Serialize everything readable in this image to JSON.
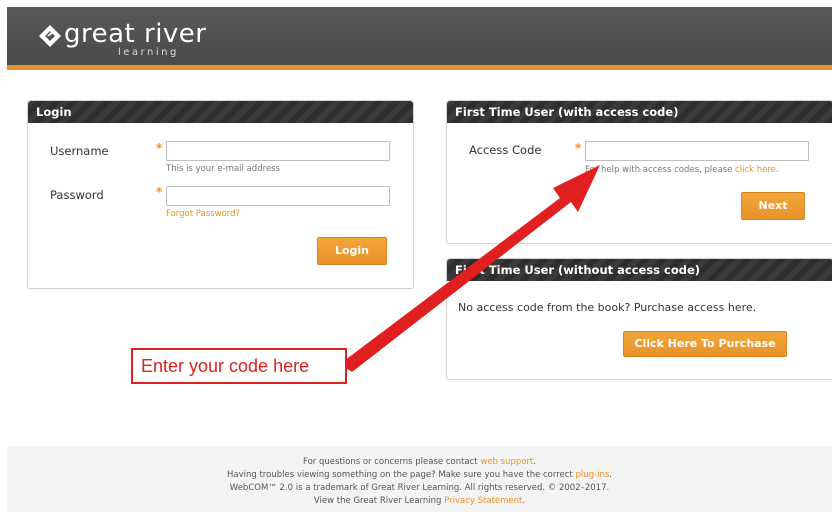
{
  "header": {
    "logo_text": "great river",
    "logo_subtext": "learning",
    "accent_color": "#e8922a"
  },
  "login": {
    "title": "Login",
    "username_label": "Username",
    "username_hint": "This is your e-mail address",
    "password_label": "Password",
    "forgot_link": "Forgot Password?",
    "required_mark": "*",
    "login_button": "Login"
  },
  "access_code_panel": {
    "title": "First Time User (with access code)",
    "access_code_label": "Access Code",
    "help_text": "For help with access codes, please",
    "help_link": "click here",
    "help_end": ".",
    "required_mark": "*",
    "next_button": "Next"
  },
  "purchase_panel": {
    "title": "First Time User (without access code)",
    "body": "No access code from the book? Purchase access here.",
    "purchase_button": "Click Here To Purchase"
  },
  "annotation": {
    "text": "Enter your code here",
    "color": "#e02020"
  },
  "footer": {
    "line1_text": "For questions or concerns please contact",
    "line1_link": "web support",
    "line1_end": ".",
    "line2_text": "Having troubles viewing something on the page? Make sure you have the correct",
    "line2_link": "plug-ins",
    "line2_end": ".",
    "line3_text": "WebCOM™ 2.0 is a trademark of Great River Learning. All rights reserved. © 2002–2017.",
    "line4_text": "View the Great River Learning",
    "line4_link": "Privacy Statement",
    "line4_end": "."
  }
}
